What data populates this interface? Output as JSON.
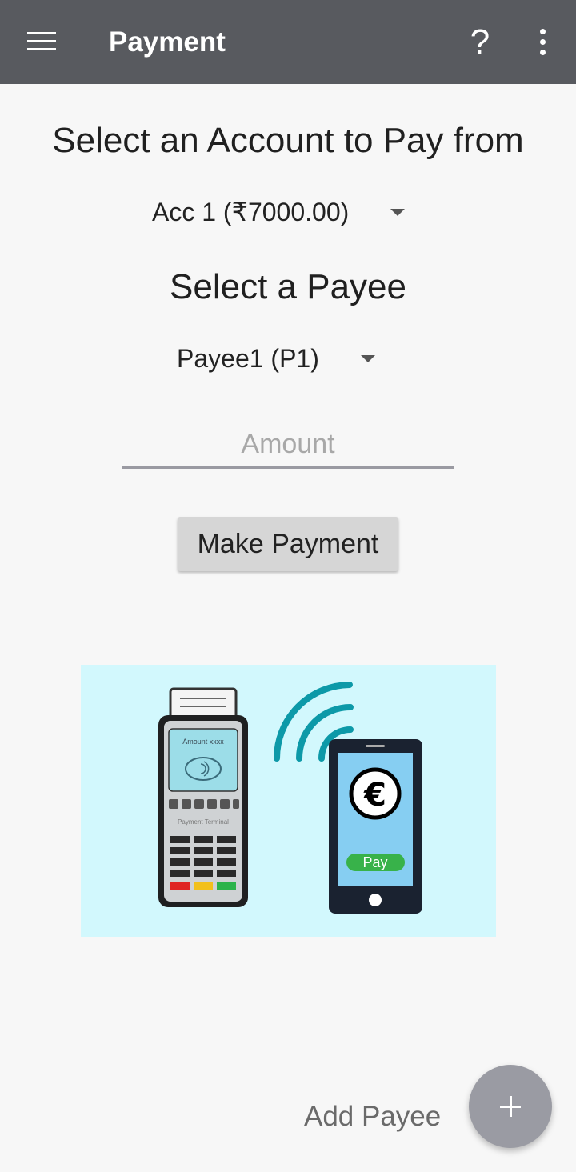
{
  "appbar": {
    "title": "Payment",
    "menu_icon": "hamburger-menu-icon",
    "help_icon": "?",
    "overflow_icon": "more-vert-icon",
    "background": "#585a5f"
  },
  "account_section": {
    "heading": "Select an Account to Pay from",
    "selected_account": "Acc 1 (₹7000.00)"
  },
  "payee_section": {
    "heading": "Select a Payee",
    "selected_payee": "Payee1 (P1)"
  },
  "amount_field": {
    "value": "",
    "placeholder": "Amount"
  },
  "make_payment_label": "Make Payment",
  "illustration": {
    "terminal_screen_text": "Amount xxxx",
    "terminal_label": "Payment Terminal",
    "phone_button_text": "Pay",
    "currency_symbol": "€",
    "background": "#d2f8fd"
  },
  "add_payee_label": "Add Payee",
  "fab_icon": "plus-icon"
}
